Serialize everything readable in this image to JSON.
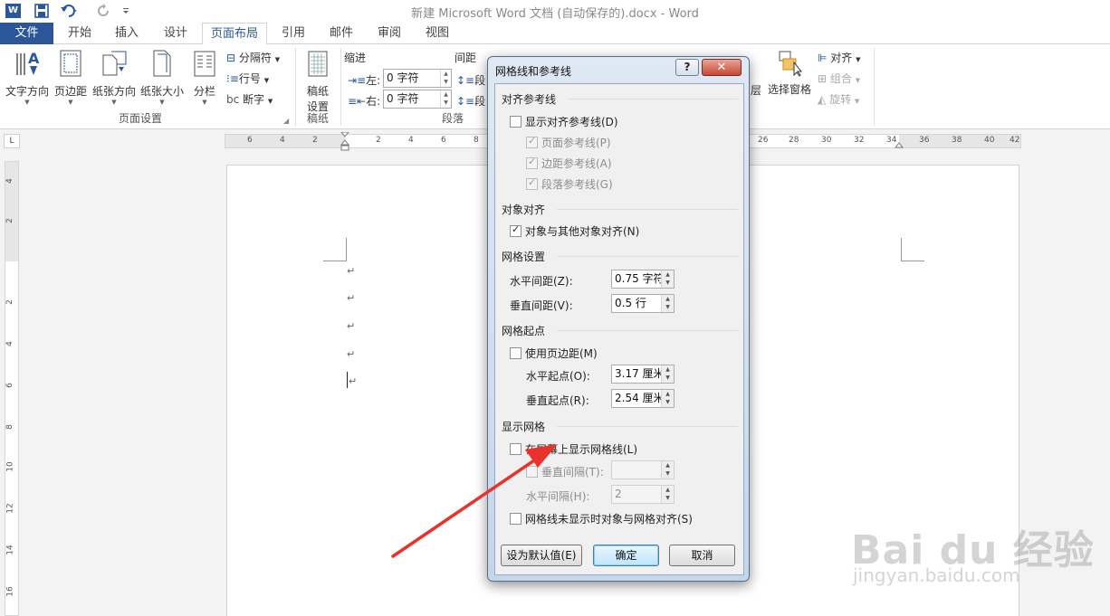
{
  "window": {
    "title": "新建 Microsoft Word 文档 (自动保存的).docx - Word",
    "app_icon_letter": "W"
  },
  "tabs": [
    "文件",
    "开始",
    "插入",
    "设计",
    "页面布局",
    "引用",
    "邮件",
    "审阅",
    "视图"
  ],
  "active_tab": "页面布局",
  "ribbon": {
    "page_setup": {
      "buttons": [
        "文字方向",
        "页边距",
        "纸张方向",
        "纸张大小",
        "分栏"
      ],
      "small": [
        "分隔符",
        "行号",
        "断字"
      ],
      "label": "页面设置"
    },
    "draft": {
      "button_line1": "稿纸",
      "button_line2": "设置",
      "label": "稿纸"
    },
    "paragraph": {
      "indent_title": "缩进",
      "spacing_title": "间距",
      "left_label": "左:",
      "right_label": "右:",
      "left_value": "0 字符",
      "right_value": "0 字符",
      "spacing_label": "段",
      "label": "段落"
    },
    "arrange": {
      "layer_label": "层",
      "selection_pane": "选择窗格",
      "align": "对齐",
      "group": "组合",
      "rotate": "旋转"
    }
  },
  "ruler": {
    "h_numbers_left": [
      "6",
      "4",
      "2"
    ],
    "h_numbers_right": [
      "2",
      "4",
      "6",
      "8"
    ],
    "h_numbers_far": [
      "26",
      "28",
      "30",
      "32",
      "34",
      "36",
      "38",
      "40",
      "42"
    ],
    "v_numbers": [
      "4",
      "2",
      "2",
      "4",
      "6",
      "8",
      "10",
      "12",
      "14",
      "16"
    ],
    "tab_selector": "L"
  },
  "document": {
    "para_mark": "↵"
  },
  "dialog": {
    "title": "网格线和参考线",
    "help": "?",
    "close": "✕",
    "sections": {
      "align_guides": "对齐参考线",
      "object_align": "对象对齐",
      "grid_settings": "网格设置",
      "grid_origin": "网格起点",
      "show_grid": "显示网格"
    },
    "checkboxes": {
      "show_align_guides": "显示对齐参考线(D)",
      "page_guides": "页面参考线(P)",
      "margin_guides": "边距参考线(A)",
      "paragraph_guides": "段落参考线(G)",
      "snap_objects": "对象与其他对象对齐(N)",
      "use_margins": "使用页边距(M)",
      "display_gridlines": "在屏幕上显示网格线(L)",
      "snap_when_hidden": "网格线未显示时对象与网格对齐(S)"
    },
    "fields": {
      "h_spacing_label": "水平间距(Z):",
      "h_spacing_value": "0.75 字符",
      "v_spacing_label": "垂直间距(V):",
      "v_spacing_value": "0.5 行",
      "h_origin_label": "水平起点(O):",
      "h_origin_value": "3.17 厘米",
      "v_origin_label": "垂直起点(R):",
      "v_origin_value": "2.54 厘米",
      "v_interval_label": "垂直间隔(T):",
      "v_interval_value": "",
      "h_interval_label": "水平间隔(H):",
      "h_interval_value": "2"
    },
    "buttons": {
      "set_default": "设为默认值(E)",
      "ok": "确定",
      "cancel": "取消"
    }
  },
  "watermark": {
    "brand": "Bai du 经验",
    "url": "jingyan.baidu.com"
  },
  "colors": {
    "accent": "#2b579a",
    "arrow": "#e8322b"
  }
}
